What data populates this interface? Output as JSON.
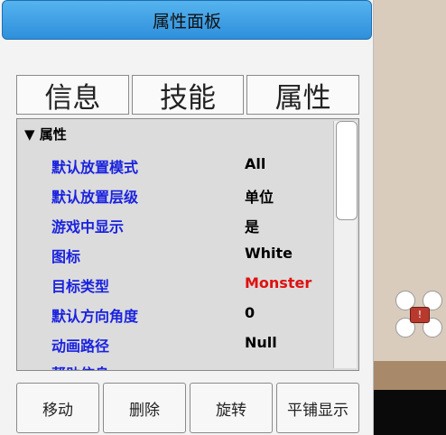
{
  "panel": {
    "title": "属性面板"
  },
  "tabs": [
    {
      "label": "信息"
    },
    {
      "label": "技能"
    },
    {
      "label": "属性"
    }
  ],
  "section": {
    "title": "▼ 属性"
  },
  "properties": [
    {
      "key": "默认放置模式",
      "value": "All"
    },
    {
      "key": "默认放置层级",
      "value": "单位"
    },
    {
      "key": "游戏中显示",
      "value": "是"
    },
    {
      "key": "图标",
      "value": "White"
    },
    {
      "key": "目标类型",
      "value": "Monster"
    },
    {
      "key": "默认方向角度",
      "value": "0"
    },
    {
      "key": "动画路径",
      "value": "Null"
    },
    {
      "key": "帮助信息",
      "value": ""
    }
  ],
  "buttons": [
    {
      "label": "移动"
    },
    {
      "label": "删除"
    },
    {
      "label": "旋转"
    },
    {
      "label": "平铺显示"
    }
  ],
  "colors": {
    "title_bar": "#3a9ee6",
    "key_text": "#1a22e0",
    "highlight_value": "#e01010"
  },
  "scene": {
    "target_marker": "!"
  }
}
